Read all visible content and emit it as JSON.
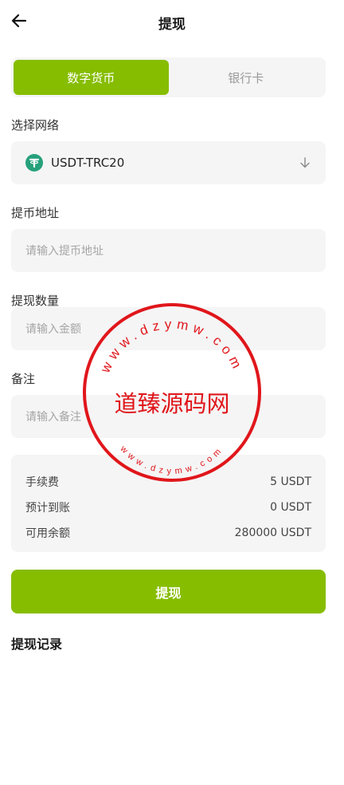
{
  "header": {
    "title": "提现"
  },
  "tabs": [
    {
      "label": "数字货币",
      "active": true
    },
    {
      "label": "银行卡",
      "active": false
    }
  ],
  "network": {
    "label": "选择网络",
    "value": "USDT-TRC20"
  },
  "address": {
    "label": "提币地址",
    "placeholder": "请输入提币地址"
  },
  "amount": {
    "label": "提现数量",
    "placeholder": "请输入金额"
  },
  "remark": {
    "label": "备注",
    "placeholder": "请输入备注"
  },
  "summary": [
    {
      "label": "手续费",
      "value": "5 USDT"
    },
    {
      "label": "预计到账",
      "value": "0 USDT"
    },
    {
      "label": "可用余额",
      "value": "280000 USDT"
    }
  ],
  "submit_label": "提现",
  "records_title": "提现记录",
  "watermark": {
    "center": "道臻源码网",
    "top_arc": "www.dzymw.com",
    "bottom_arc": "www.dzymw.com"
  },
  "colors": {
    "accent": "#86bd00",
    "field_bg": "#f5f5f5",
    "stamp": "#e0161b",
    "tether": "#26a17b"
  }
}
